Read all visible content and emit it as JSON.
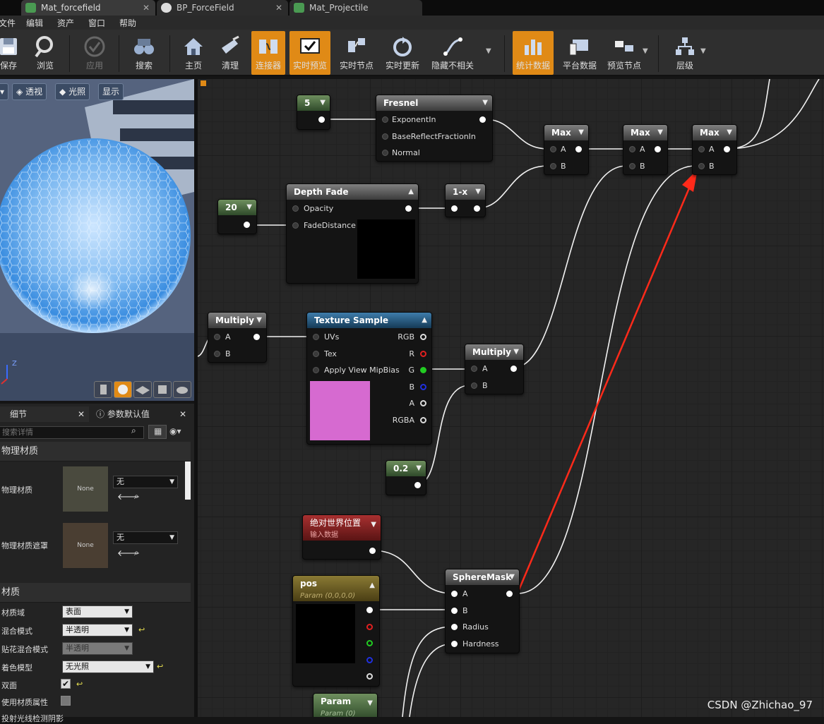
{
  "tabs": [
    {
      "label": "Mat_forcefield",
      "color": "#4a9a52"
    },
    {
      "label": "BP_ForceField",
      "color": "#ddd"
    },
    {
      "label": "Mat_Projectile",
      "color": "#4a9a52"
    }
  ],
  "menu": [
    "文件",
    "编辑",
    "资产",
    "窗口",
    "帮助"
  ],
  "toolbar": {
    "save": "保存",
    "browse": "浏览",
    "apply": "应用",
    "search": "搜索",
    "home": "主页",
    "clean": "清理",
    "connectors": "连接器",
    "live_preview": "实时预览",
    "live_nodes": "实时节点",
    "live_update": "实时更新",
    "hide_unrelated": "隐藏不相关",
    "stats": "统计数据",
    "platform": "平台数据",
    "preview_node": "预览节点",
    "hierarchy": "层级"
  },
  "viewport": {
    "perspective": "透视",
    "lit": "光照",
    "show": "显示",
    "axis_z": "Z"
  },
  "details": {
    "tab_details": "细节",
    "tab_params": "参数默认值",
    "search_placeholder": "搜索详情",
    "section_phys": "物理材质",
    "phys_label": "物理材质",
    "phys_mask_label": "物理材质遮罩",
    "thumb_none": "None",
    "value_none": "无",
    "section_mat": "材质",
    "props": [
      {
        "label": "材质域",
        "value": "表面"
      },
      {
        "label": "混合模式",
        "value": "半透明"
      },
      {
        "label": "贴花混合模式",
        "value": "半透明"
      },
      {
        "label": "着色模型",
        "value": "无光照"
      },
      {
        "label": "双面",
        "value": "✔"
      },
      {
        "label": "使用材质属性",
        "value": ""
      },
      {
        "label": "投射光线检测阴影",
        "value": ""
      }
    ]
  },
  "nodes": {
    "const5": {
      "value": "5"
    },
    "fresnel": {
      "title": "Fresnel",
      "pins": [
        "ExponentIn",
        "BaseReflectFractionIn",
        "Normal"
      ]
    },
    "max": {
      "title": "Max",
      "a": "A",
      "b": "B"
    },
    "const20": {
      "value": "20"
    },
    "depthfade": {
      "title": "Depth Fade",
      "pins": [
        "Opacity",
        "FadeDistance"
      ]
    },
    "oneminus": {
      "title": "1-x"
    },
    "multiply": {
      "title": "Multiply",
      "a": "A",
      "b": "B"
    },
    "texsample": {
      "title": "Texture Sample",
      "inputs": [
        "UVs",
        "Tex",
        "Apply View MipBias"
      ],
      "outputs": [
        "RGB",
        "R",
        "G",
        "B",
        "A",
        "RGBA"
      ]
    },
    "const02": {
      "value": "0.2"
    },
    "absworld": {
      "title": "绝对世界位置",
      "subtitle": "输入数据"
    },
    "pos": {
      "title": "pos",
      "subtitle": "Param (0,0,0,0)"
    },
    "spheremask": {
      "title": "SphereMask",
      "pins": [
        "A",
        "B",
        "Radius",
        "Hardness"
      ]
    },
    "param": {
      "title": "Param",
      "subtitle": "Param (0)"
    }
  },
  "colors": {
    "accent": "#e08a16",
    "arrow": "#ff2a1a",
    "pin_r": "#e02020",
    "pin_g": "#22cc22",
    "pin_b": "#2030e0"
  },
  "watermark": "CSDN @Zhichao_97"
}
